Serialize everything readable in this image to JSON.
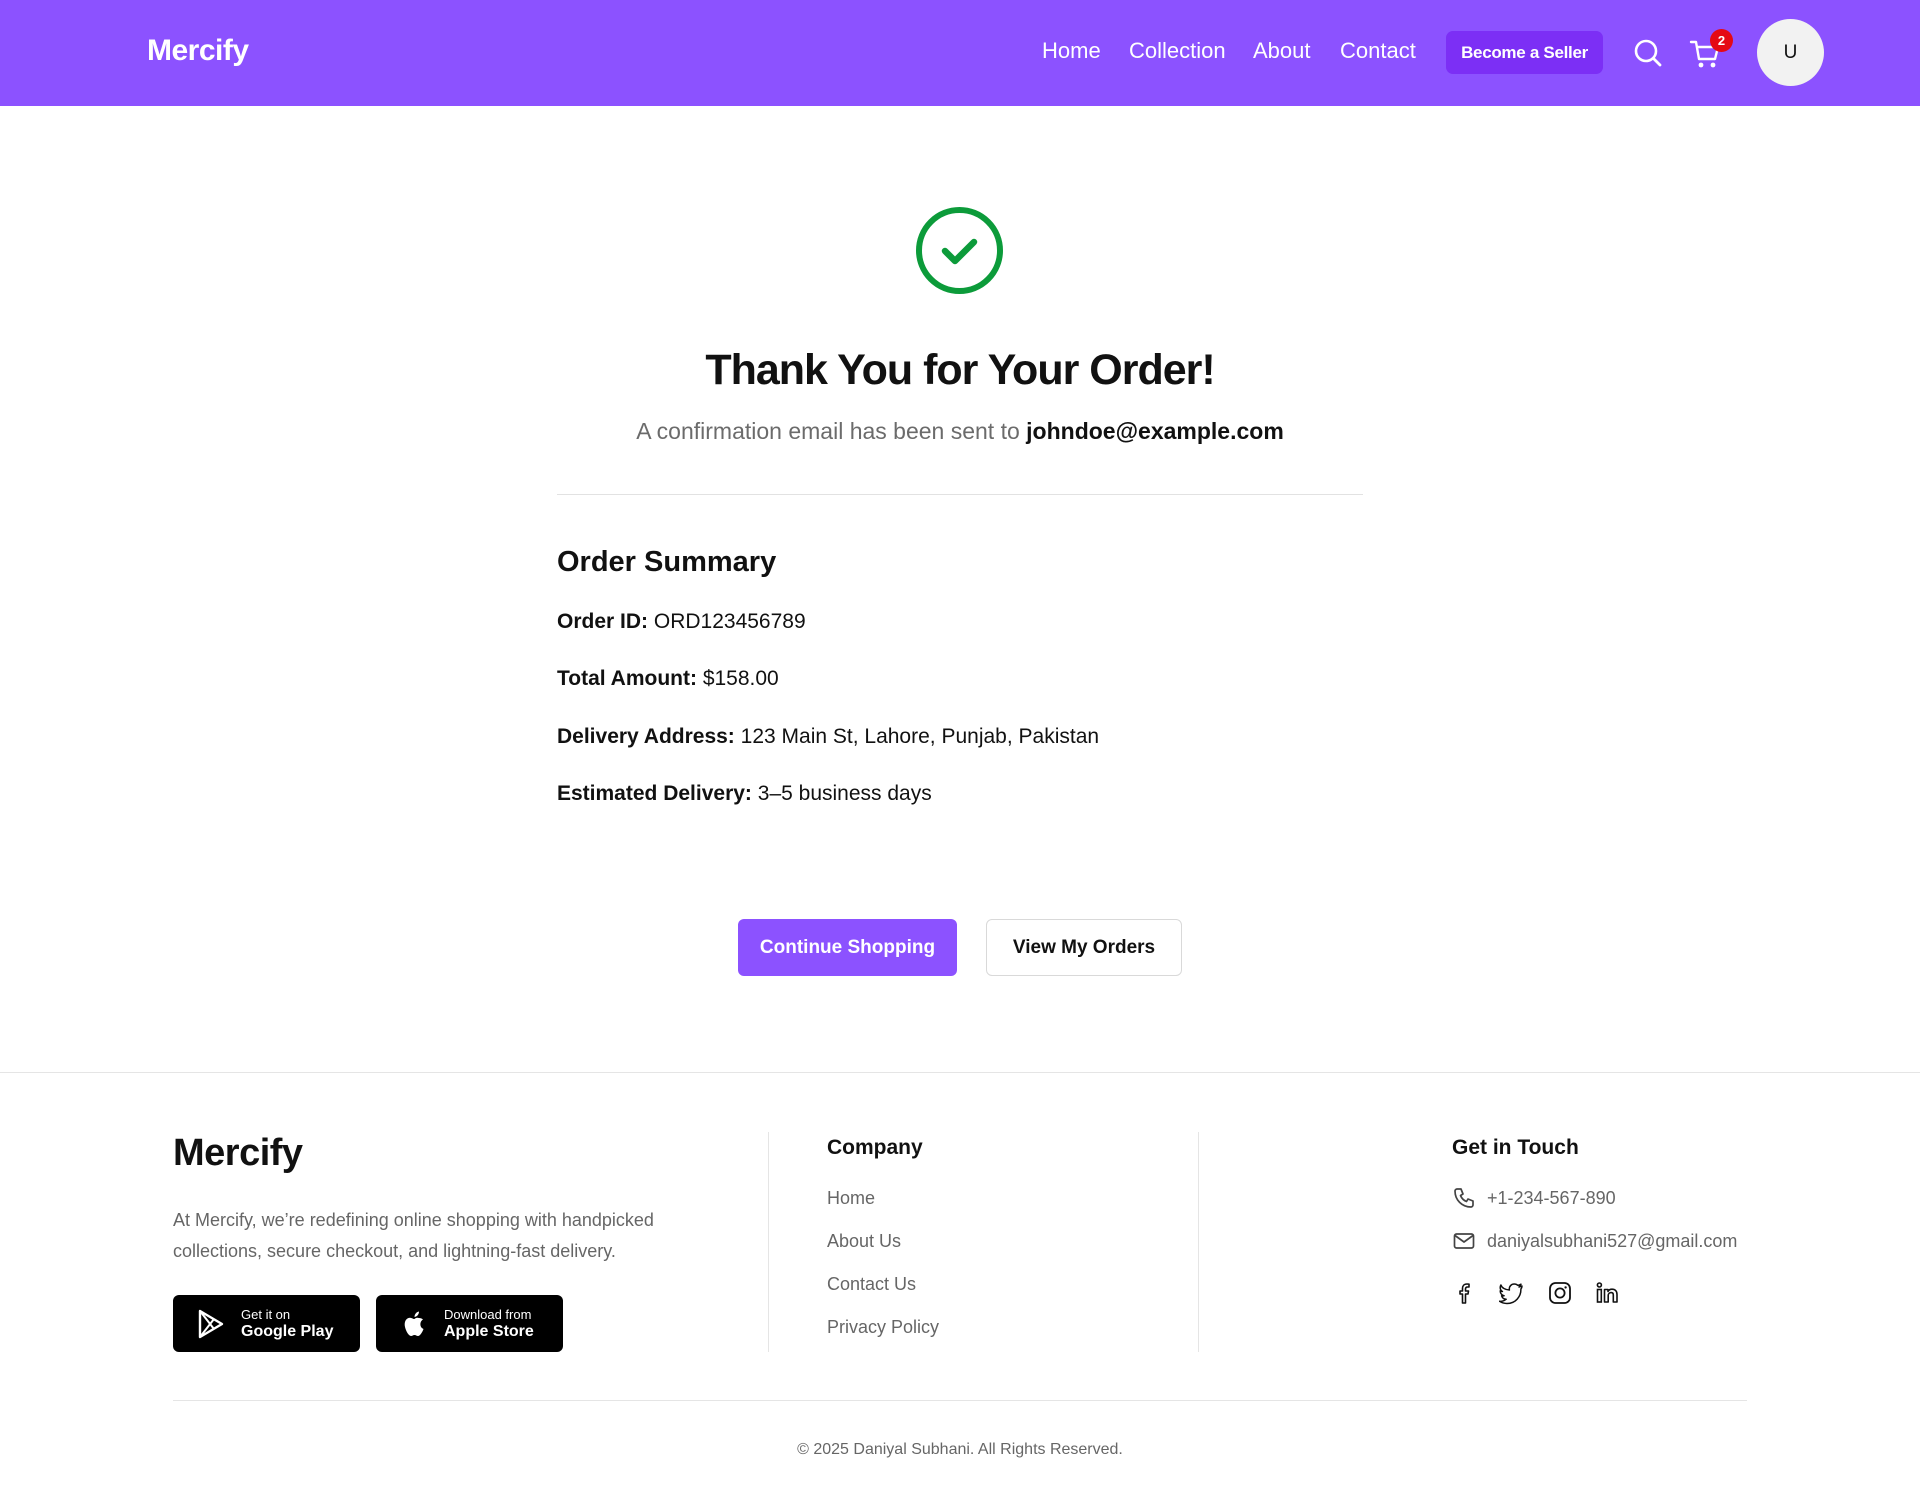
{
  "header": {
    "logo": "Mercify",
    "nav": [
      "Home",
      "Collection",
      "About",
      "Contact"
    ],
    "seller_button": "Become a Seller",
    "cart_count": "2",
    "avatar_initial": "U",
    "bg_color": "#8c52ff"
  },
  "confirmation": {
    "title": "Thank You for Your Order!",
    "subtitle_prefix": "A confirmation email has been sent to",
    "email": "johndoe@example.com",
    "check_color": "#0c9b3a"
  },
  "summary": {
    "title": "Order Summary",
    "rows": [
      {
        "label": "Order ID:",
        "value": "ORD123456789"
      },
      {
        "label": "Total Amount:",
        "value": "$158.00"
      },
      {
        "label": "Delivery Address:",
        "value": "123 Main St, Lahore, Punjab, Pakistan"
      },
      {
        "label": "Estimated Delivery:",
        "value": "3–5 business days"
      }
    ]
  },
  "actions": {
    "continue": "Continue Shopping",
    "orders": "View My Orders"
  },
  "footer": {
    "logo": "Mercify",
    "about": "At Mercify, we’re redefining online shopping with handpicked collections, secure checkout, and lightning-fast delivery.",
    "google_play": {
      "small": "Get it on",
      "big": "Google Play"
    },
    "apple_store": {
      "small": "Download from",
      "big": "Apple Store"
    },
    "company_title": "Company",
    "company_links": [
      "Home",
      "About Us",
      "Contact Us",
      "Privacy Policy"
    ],
    "contact_title": "Get in Touch",
    "phone": "+1-234-567-890",
    "email": "daniyalsubhani527@gmail.com",
    "social_icons": [
      "facebook-icon",
      "twitter-icon",
      "instagram-icon",
      "linkedin-icon"
    ],
    "copyright": "© 2025 Daniyal Subhani. All Rights Reserved."
  }
}
